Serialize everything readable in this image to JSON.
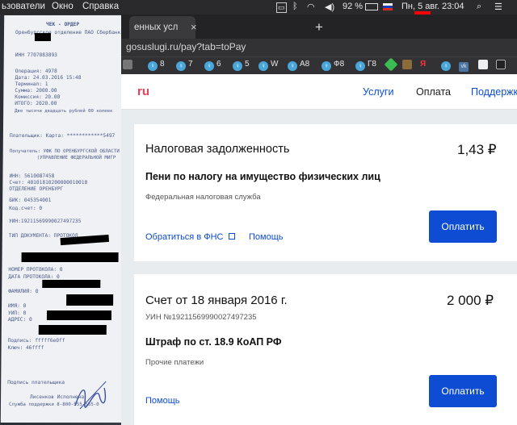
{
  "menubar": {
    "items": [
      "ьзователи",
      "Окно",
      "Справка"
    ],
    "battery": "92 %",
    "datetime": "Пн, 5 авг.  23:04"
  },
  "browser": {
    "tab_title": "енных усл",
    "new_tab": "+",
    "close": "×",
    "url": "gosuslugi.ru/pay?tab=toPay",
    "bookmarks": [
      "8",
      "7",
      "6",
      "5",
      "W",
      "A8",
      "Ф8",
      "Г8"
    ]
  },
  "site": {
    "logo": "ru",
    "nav": [
      "Услуги",
      "Оплата",
      "Поддержка"
    ]
  },
  "cards": [
    {
      "title": "Налоговая задолженность",
      "amount": "1,43 ₽",
      "subject": "Пени по налогу на имущество физических лиц",
      "issuer": "Федеральная налоговая служба",
      "link1": "Обратиться в ФНС",
      "link2": "Помощь",
      "button": "Оплатить"
    },
    {
      "title": "Счет от 18 января 2016 г.",
      "amount": "2 000 ₽",
      "uin": "УИН №19211569990027497235",
      "subject": "Штраф по ст. 18.9 КоАП РФ",
      "issuer": "Прочие платежи",
      "link1": "Помощь",
      "button": "Оплатить"
    }
  ],
  "receipt": {
    "lines": [
      "ЧЕК - ОРДЕР",
      "Оренбургское отделение ПАО Сбербанк Росс",
      "ИНН 7707083893",
      "Операция:    4978",
      "Дата:        24.03.2016 15:48",
      "Терминал:    1",
      "Сумма:       2000.00",
      "Комиссия:    20.00",
      "ИТОГО:       2020.00",
      "Две тысячи двадцать рублей 00 копеек",
      "Плательщик: Карта: ************5497",
      "Получатель: УФК ПО ОРЕНБУРГСКОЙ ОБЛАСТИ",
      "(УПРАВЛЕНИЕ ФЕДЕРАЛЬНОЙ МИГР",
      "ИНН:   5610087458",
      "Счет:  40101810200000010010",
      "       ОТДЕЛЕНИЕ ОРЕНБУРГ",
      "БИК:   045354001",
      "Код.счет:   0",
      "УИН:19211569990027497235",
      "ТИП ДОКУМЕНТА: ПРОТОКОЛ",
      "НОМЕР ПРОТОКОЛА: 0",
      "ДАТА ПРОТОКОЛА: 0",
      "ФАМИЛИЯ: 0",
      "ИМЯ: 0",
      "УИП: 0",
      "АДРЕС: 0",
      "Подпись:  fffff6e0ff",
      "Ключ:     46ffff",
      "Подпись плательщика",
      "Лисенков Исполнена",
      "Служба поддержки 8-800-555-555-0"
    ]
  },
  "colors": {
    "accent": "#0d4cd3",
    "logo": "#ee3f58",
    "redaction": "#000000",
    "marker": "#ff0000"
  }
}
